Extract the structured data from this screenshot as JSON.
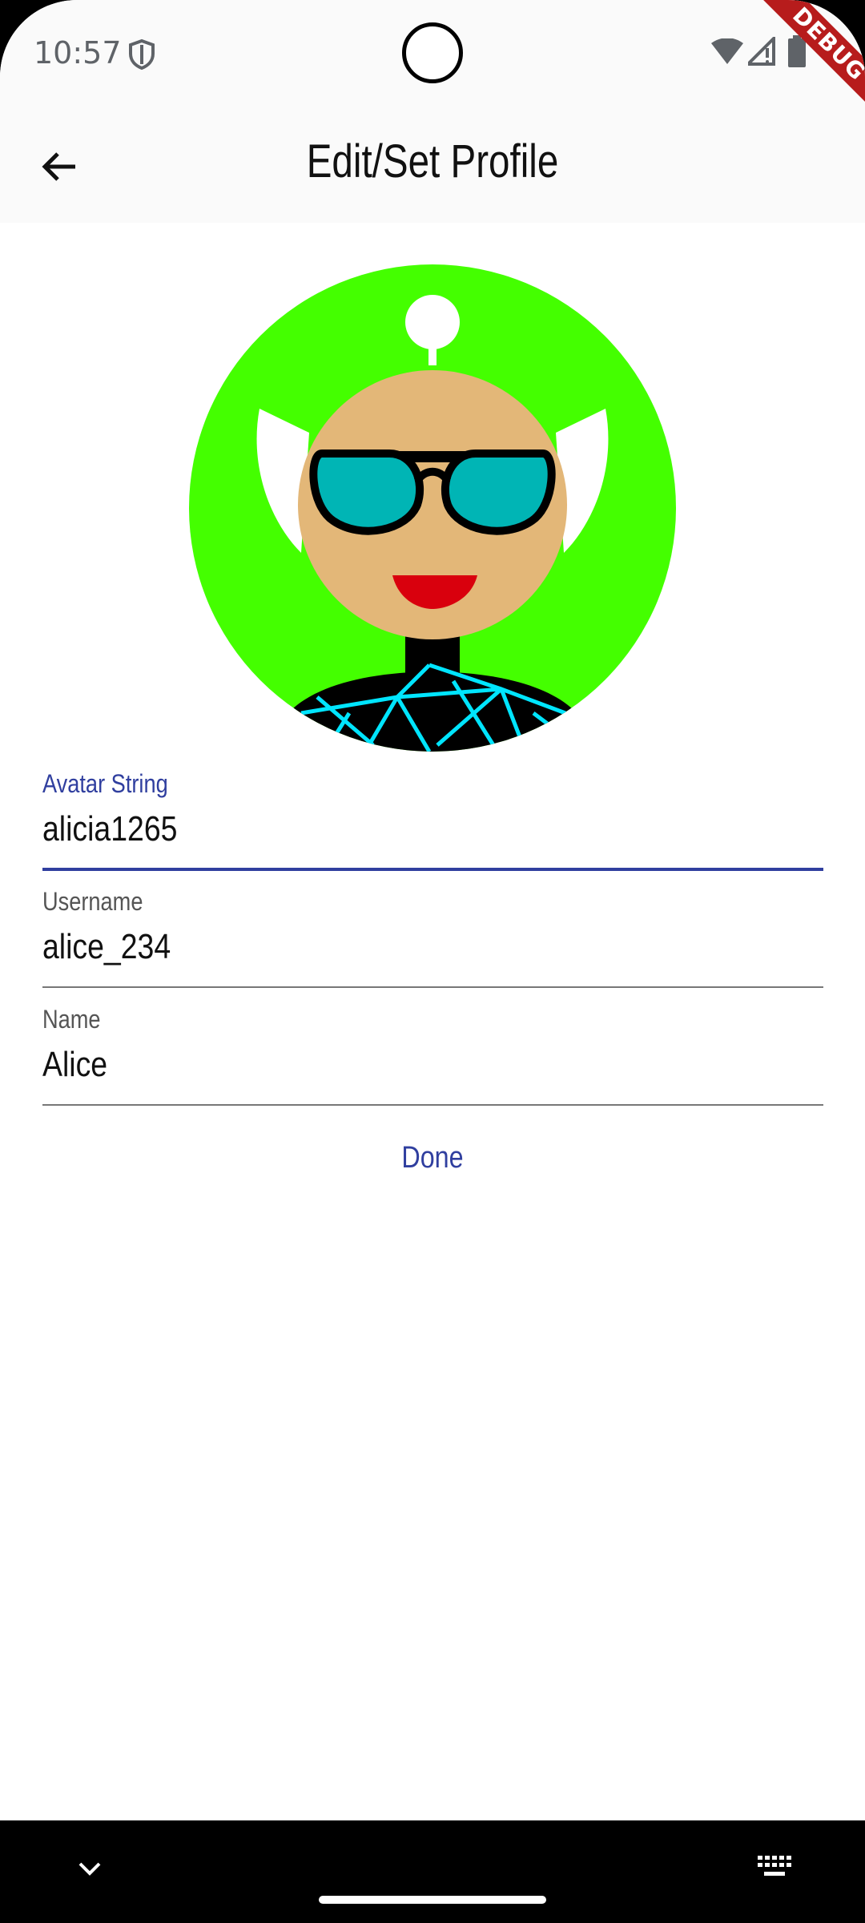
{
  "status_bar": {
    "time": "10:57",
    "debug_label": "DEBUG"
  },
  "app_bar": {
    "title": "Edit/Set Profile"
  },
  "form": {
    "avatar_string": {
      "label": "Avatar String",
      "value": "alicia1265"
    },
    "username": {
      "label": "Username",
      "value": "alice_234"
    },
    "name": {
      "label": "Name",
      "value": "Alice"
    },
    "done_label": "Done"
  },
  "colors": {
    "accent": "#303f9f",
    "avatar_background": "#44ff00",
    "skin": "#e3b778",
    "lens": "#00b5b5",
    "lips": "#d9000d",
    "shirt_lines": "#00e5ff"
  }
}
